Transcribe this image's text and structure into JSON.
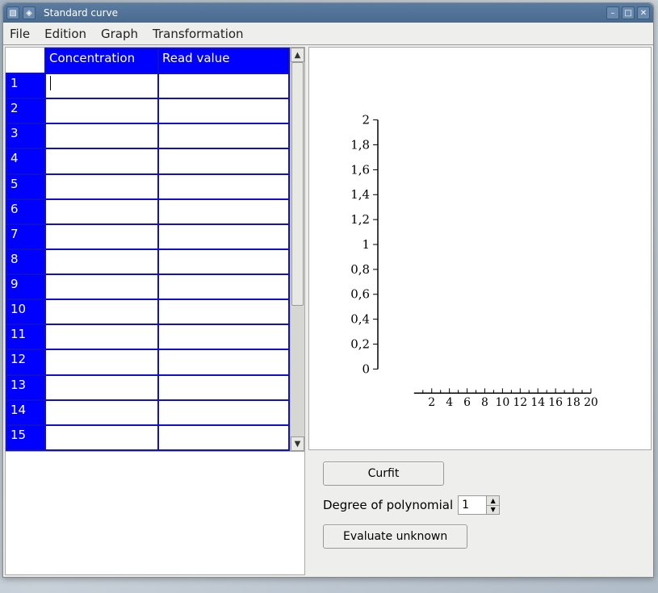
{
  "window": {
    "title": "Standard curve"
  },
  "menu": {
    "items": [
      "File",
      "Edition",
      "Graph",
      "Transformation"
    ]
  },
  "table": {
    "columns": [
      "Concentration",
      "Read value"
    ],
    "row_count": 15,
    "rows": [
      {
        "n": "1",
        "c": "",
        "v": ""
      },
      {
        "n": "2",
        "c": "",
        "v": ""
      },
      {
        "n": "3",
        "c": "",
        "v": ""
      },
      {
        "n": "4",
        "c": "",
        "v": ""
      },
      {
        "n": "5",
        "c": "",
        "v": ""
      },
      {
        "n": "6",
        "c": "",
        "v": ""
      },
      {
        "n": "7",
        "c": "",
        "v": ""
      },
      {
        "n": "8",
        "c": "",
        "v": ""
      },
      {
        "n": "9",
        "c": "",
        "v": ""
      },
      {
        "n": "10",
        "c": "",
        "v": ""
      },
      {
        "n": "11",
        "c": "",
        "v": ""
      },
      {
        "n": "12",
        "c": "",
        "v": ""
      },
      {
        "n": "13",
        "c": "",
        "v": ""
      },
      {
        "n": "14",
        "c": "",
        "v": ""
      },
      {
        "n": "15",
        "c": "",
        "v": ""
      }
    ]
  },
  "chart_data": {
    "type": "scatter",
    "x": [],
    "y": [],
    "title": "",
    "xlabel": "",
    "ylabel": "",
    "xlim": [
      0,
      20
    ],
    "ylim": [
      0,
      2
    ],
    "xticks": [
      2,
      4,
      6,
      8,
      10,
      12,
      14,
      16,
      18,
      20
    ],
    "yticks_labels": [
      "0",
      "0,2",
      "0,4",
      "0,6",
      "0,8",
      "1",
      "1,2",
      "1,4",
      "1,6",
      "1,8",
      "2"
    ],
    "yticks_values": [
      0,
      0.2,
      0.4,
      0.6,
      0.8,
      1,
      1.2,
      1.4,
      1.6,
      1.8,
      2
    ]
  },
  "buttons": {
    "curfit": "Curfit",
    "evaluate": "Evaluate unknown",
    "degree_label": "Degree of polynomial",
    "degree_value": "1"
  }
}
